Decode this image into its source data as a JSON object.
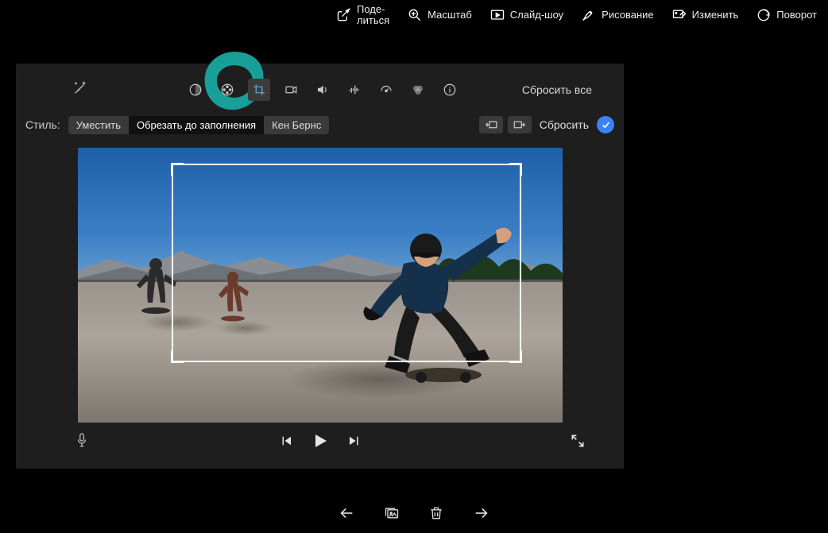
{
  "top_menu": {
    "share": "Поде-\nлиться",
    "zoom": "Масштаб",
    "slideshow": "Слайд-шоу",
    "draw": "Рисование",
    "edit": "Изменить",
    "rotate": "Поворот"
  },
  "toolbar": {
    "reset_all": "Сбросить все"
  },
  "style_row": {
    "label": "Стиль:",
    "fit": "Уместить",
    "crop_fill": "Обрезать до заполнения",
    "ken_burns": "Кен Бернс",
    "reset": "Сбросить"
  },
  "highlight_color": "#18a89f"
}
